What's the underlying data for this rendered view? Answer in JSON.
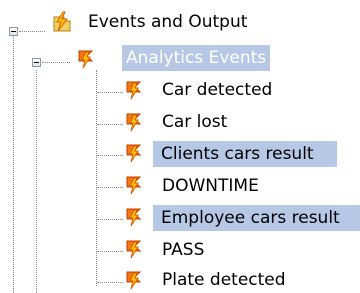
{
  "tree": {
    "root": {
      "label": "Events and Output",
      "icon": "lightning-folder-icon",
      "expanded": true
    },
    "group": {
      "label": "Analytics Events",
      "icon": "lightning-flag-icon",
      "expanded": true,
      "selected": true
    },
    "items": [
      {
        "label": "Car detected",
        "icon": "lightning-flag-icon",
        "selected": false
      },
      {
        "label": "Car lost",
        "icon": "lightning-flag-icon",
        "selected": false
      },
      {
        "label": "Clients cars result",
        "icon": "lightning-flag-icon",
        "selected": true
      },
      {
        "label": "DOWNTIME",
        "icon": "lightning-flag-icon",
        "selected": false
      },
      {
        "label": "Employee cars result",
        "icon": "lightning-flag-icon",
        "selected": true
      },
      {
        "label": "PASS",
        "icon": "lightning-flag-icon",
        "selected": false
      },
      {
        "label": "Plate detected",
        "icon": "lightning-flag-icon",
        "selected": false
      }
    ]
  },
  "colors": {
    "selection": "#b6c8e6",
    "flag_orange": "#f07818",
    "bolt_yellow": "#ffc800"
  }
}
